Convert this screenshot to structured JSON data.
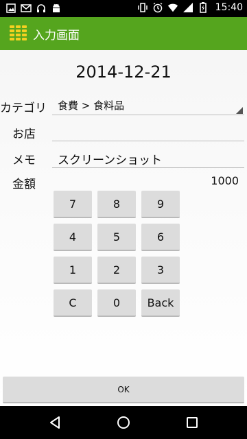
{
  "status_bar": {
    "time": "15:40",
    "left_icons": [
      "image-icon",
      "gmail-icon",
      "headphones-icon",
      "android-icon"
    ],
    "right_icons": [
      "vibrate-icon",
      "alarm-icon",
      "wifi-icon",
      "signal-icon",
      "battery-icon"
    ]
  },
  "action_bar": {
    "title": "入力画面",
    "icon": "grid-app-icon",
    "color": "#55a51e"
  },
  "form": {
    "date": "2014-12-21",
    "category_label": "カテゴリ",
    "category_value": "食費 > 食料品",
    "shop_label": "お店",
    "shop_value": "",
    "memo_label": "メモ",
    "memo_value": "スクリーンショット",
    "amount_label": "金額",
    "amount_value": "1000"
  },
  "keypad": {
    "keys": [
      "7",
      "8",
      "9",
      "4",
      "5",
      "6",
      "1",
      "2",
      "3",
      "C",
      "0",
      "Back"
    ]
  },
  "ok_label": "OK",
  "nav_bar": {
    "icons": [
      "back-icon",
      "home-icon",
      "recents-icon"
    ]
  }
}
